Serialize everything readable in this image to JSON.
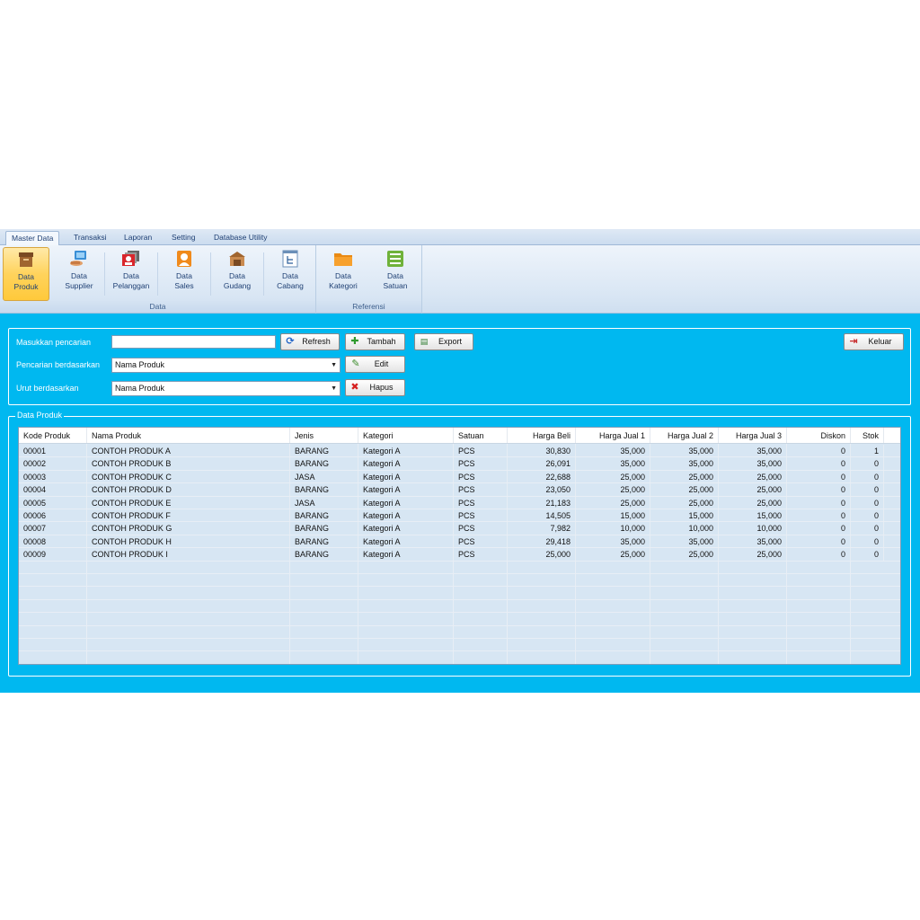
{
  "ribbon": {
    "tabs": [
      {
        "label": "Master Data",
        "active": true
      },
      {
        "label": "Transaksi"
      },
      {
        "label": "Laporan"
      },
      {
        "label": "Setting"
      },
      {
        "label": "Database Utility"
      }
    ],
    "groups": {
      "data": {
        "label": "Data",
        "buttons": [
          {
            "line1": "Data",
            "line2": "Produk",
            "icon": "box-icon",
            "active": true
          },
          {
            "line1": "Data",
            "line2": "Supplier",
            "icon": "supplier-icon"
          },
          {
            "line1": "Data",
            "line2": "Pelanggan",
            "icon": "customer-card-icon"
          },
          {
            "line1": "Data",
            "line2": "Sales",
            "icon": "person-icon"
          },
          {
            "line1": "Data",
            "line2": "Gudang",
            "icon": "warehouse-icon"
          },
          {
            "line1": "Data",
            "line2": "Cabang",
            "icon": "branch-icon"
          }
        ]
      },
      "referensi": {
        "label": "Referensi",
        "buttons": [
          {
            "line1": "Data",
            "line2": "Kategori",
            "icon": "folder-icon"
          },
          {
            "line1": "Data",
            "line2": "Satuan",
            "icon": "list-icon"
          }
        ]
      }
    }
  },
  "form": {
    "search_label": "Masukkan pencarian",
    "search_value": "",
    "search_by_label": "Pencarian berdasarkan",
    "search_by_value": "Nama Produk",
    "sort_by_label": "Urut berdasarkan",
    "sort_by_value": "Nama Produk"
  },
  "buttons": {
    "refresh": "Refresh",
    "tambah": "Tambah",
    "export": "Export",
    "edit": "Edit",
    "hapus": "Hapus",
    "keluar": "Keluar"
  },
  "grid": {
    "title": "Data Produk",
    "columns": [
      "Kode Produk",
      "Nama Produk",
      "Jenis",
      "Kategori",
      "Satuan",
      "Harga Beli",
      "Harga Jual 1",
      "Harga Jual 2",
      "Harga Jual 3",
      "Diskon",
      "Stok"
    ],
    "rows": [
      [
        "00001",
        "CONTOH PRODUK A",
        "BARANG",
        "Kategori A",
        "PCS",
        "30,830",
        "35,000",
        "35,000",
        "35,000",
        "0",
        "1"
      ],
      [
        "00002",
        "CONTOH PRODUK B",
        "BARANG",
        "Kategori A",
        "PCS",
        "26,091",
        "35,000",
        "35,000",
        "35,000",
        "0",
        "0"
      ],
      [
        "00003",
        "CONTOH PRODUK C",
        "JASA",
        "Kategori A",
        "PCS",
        "22,688",
        "25,000",
        "25,000",
        "25,000",
        "0",
        "0"
      ],
      [
        "00004",
        "CONTOH PRODUK D",
        "BARANG",
        "Kategori A",
        "PCS",
        "23,050",
        "25,000",
        "25,000",
        "25,000",
        "0",
        "0"
      ],
      [
        "00005",
        "CONTOH PRODUK E",
        "JASA",
        "Kategori A",
        "PCS",
        "21,183",
        "25,000",
        "25,000",
        "25,000",
        "0",
        "0"
      ],
      [
        "00006",
        "CONTOH PRODUK F",
        "BARANG",
        "Kategori A",
        "PCS",
        "14,505",
        "15,000",
        "15,000",
        "15,000",
        "0",
        "0"
      ],
      [
        "00007",
        "CONTOH PRODUK G",
        "BARANG",
        "Kategori A",
        "PCS",
        "7,982",
        "10,000",
        "10,000",
        "10,000",
        "0",
        "0"
      ],
      [
        "00008",
        "CONTOH PRODUK H",
        "BARANG",
        "Kategori A",
        "PCS",
        "29,418",
        "35,000",
        "35,000",
        "35,000",
        "0",
        "0"
      ],
      [
        "00009",
        "CONTOH PRODUK I",
        "BARANG",
        "Kategori A",
        "PCS",
        "25,000",
        "25,000",
        "25,000",
        "25,000",
        "0",
        "0"
      ]
    ]
  },
  "colors": {
    "content_bg": "#00b8f0",
    "ribbon_active": "#ffd35c",
    "grid_bg": "#d7e6f3"
  }
}
